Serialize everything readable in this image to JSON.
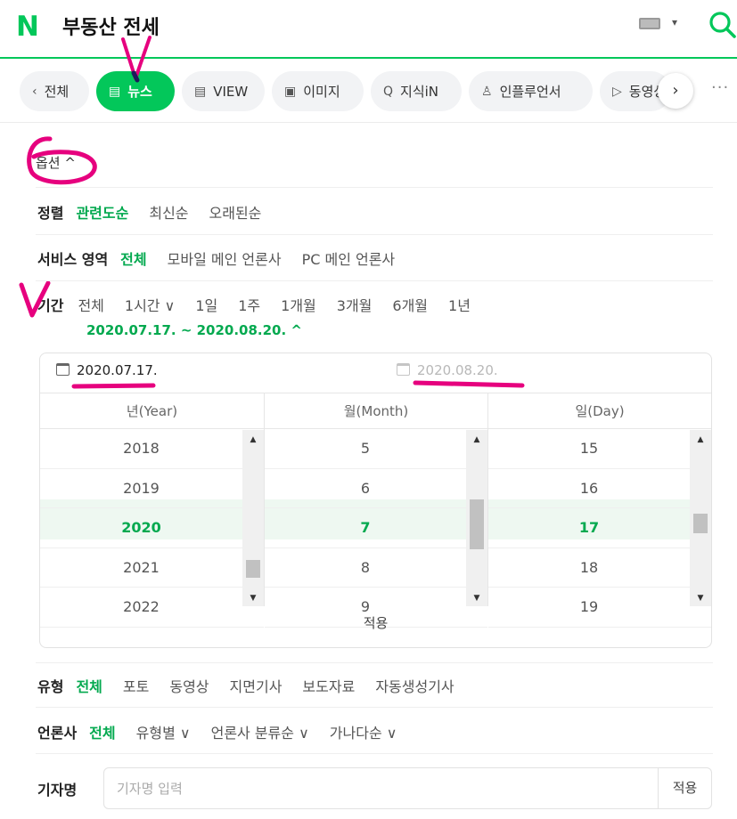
{
  "header": {
    "logo": "N",
    "query": "부동산 전세",
    "keyboard_caret": "▾"
  },
  "tabs": {
    "back_label": "전체",
    "items": [
      {
        "label": "뉴스",
        "icon": "news-icon",
        "active": true
      },
      {
        "label": "VIEW",
        "icon": "document-icon"
      },
      {
        "label": "이미지",
        "icon": "image-icon"
      },
      {
        "label": "지식iN",
        "icon": "qna-icon"
      },
      {
        "label": "인플루언서",
        "icon": "person-icon"
      },
      {
        "label": "동영상",
        "icon": "play-icon"
      }
    ],
    "next": "›",
    "more": "···"
  },
  "options": {
    "header_label": "옵션 ^",
    "sort": {
      "label": "정렬",
      "items": [
        "관련도순",
        "최신순",
        "오래된순"
      ],
      "selected": "관련도순"
    },
    "service": {
      "label": "서비스 영역",
      "items": [
        "전체",
        "모바일 메인 언론사",
        "PC 메인 언론사"
      ],
      "selected": "전체"
    },
    "period": {
      "label": "기간",
      "items": [
        "전체",
        "1시간 ∨",
        "1일",
        "1주",
        "1개월",
        "3개월",
        "6개월",
        "1년"
      ],
      "range_label": "2020.07.17. ~ 2020.08.20. ^"
    },
    "type": {
      "label": "유형",
      "items": [
        "전체",
        "포토",
        "동영상",
        "지면기사",
        "보도자료",
        "자동생성기사"
      ],
      "selected": "전체"
    },
    "press": {
      "label": "언론사",
      "items": [
        "전체",
        "유형별 ∨",
        "언론사 분류순 ∨",
        "가나다순 ∨"
      ],
      "selected": "전체"
    },
    "reporter": {
      "label": "기자명",
      "placeholder": "기자명 입력",
      "apply_label": "적용"
    }
  },
  "date_picker": {
    "from": "2020.07.17.",
    "to": "2020.08.20.",
    "columns": [
      {
        "header": "년(Year)",
        "values": [
          "2018",
          "2019",
          "2020",
          "2021",
          "2022"
        ],
        "selected_index": 2
      },
      {
        "header": "월(Month)",
        "values": [
          "5",
          "6",
          "7",
          "8",
          "9"
        ],
        "selected_index": 2
      },
      {
        "header": "일(Day)",
        "values": [
          "15",
          "16",
          "17",
          "18",
          "19"
        ],
        "selected_index": 2
      }
    ],
    "apply_label": "적용"
  },
  "colors": {
    "brand": "#03c75a",
    "selected_text": "#03a94f",
    "annotation": "#e6007e"
  }
}
